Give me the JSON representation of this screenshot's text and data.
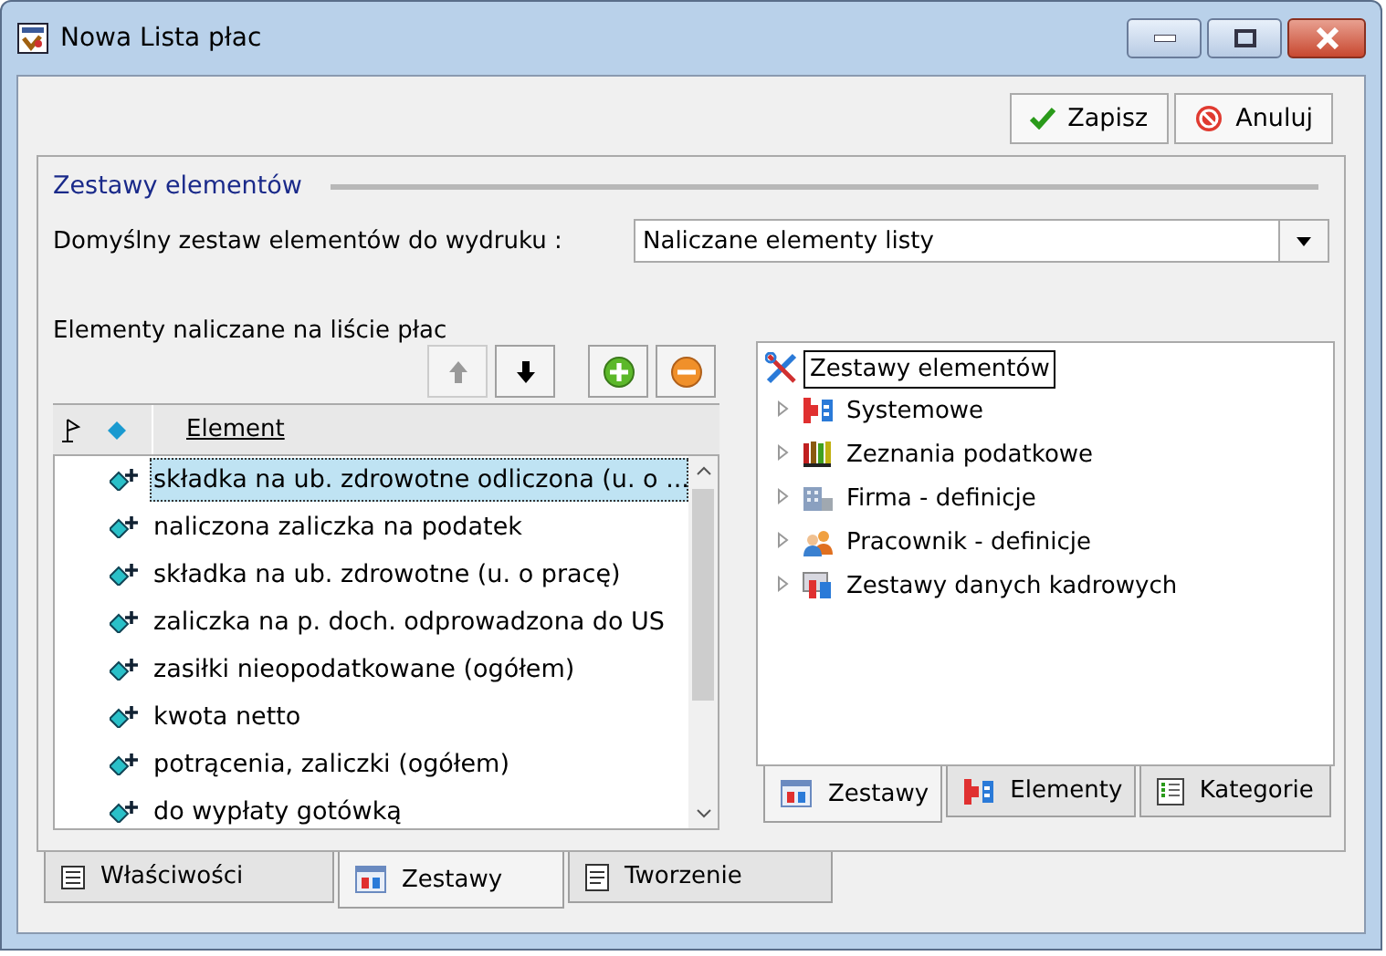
{
  "window": {
    "title": "Nowa Lista płac"
  },
  "actions": [
    {
      "label": "Zapisz",
      "kind": "save"
    },
    {
      "label": "Anuluj",
      "kind": "cancel"
    }
  ],
  "group": {
    "title": "Zestawy elementów"
  },
  "print_set": {
    "label": "Domyślny zestaw elementów do wydruku :",
    "value": "Naliczane elementy listy"
  },
  "elements": {
    "label": "Elementy naliczane na liście płac",
    "toolbar": [
      {
        "kind": "up",
        "disabled": true
      },
      {
        "kind": "down",
        "disabled": false
      },
      {
        "kind": "add",
        "disabled": false
      },
      {
        "kind": "remove",
        "disabled": false
      }
    ],
    "columns": [
      "Element"
    ],
    "rows": [
      {
        "text": "składka na ub. zdrowotne odliczona (u. o ...",
        "selected": true
      },
      {
        "text": "naliczona zaliczka na podatek",
        "selected": false
      },
      {
        "text": "składka na ub. zdrowotne (u. o pracę)",
        "selected": false
      },
      {
        "text": "zaliczka na p. doch. odprowadzona do US",
        "selected": false
      },
      {
        "text": "zasiłki nieopodatkowane (ogółem)",
        "selected": false
      },
      {
        "text": "kwota netto",
        "selected": false
      },
      {
        "text": "potrącenia, zaliczki (ogółem)",
        "selected": false
      },
      {
        "text": "do wypłaty gotówką",
        "selected": false
      }
    ]
  },
  "tree": {
    "root": "Zestawy elementów",
    "children": [
      {
        "label": "Systemowe",
        "kind": "system",
        "expanded": false
      },
      {
        "label": "Zeznania podatkowe",
        "kind": "books",
        "expanded": false
      },
      {
        "label": "Firma - definicje",
        "kind": "company",
        "expanded": false
      },
      {
        "label": "Pracownik - definicje",
        "kind": "people",
        "expanded": false
      },
      {
        "label": "Zestawy danych kadrowych",
        "kind": "hr",
        "expanded": false
      }
    ]
  },
  "tree_tabs": [
    {
      "label": "Zestawy",
      "kind": "sets",
      "selected": true
    },
    {
      "label": "Elementy",
      "kind": "system",
      "selected": false
    },
    {
      "label": "Kategorie",
      "kind": "list",
      "selected": false
    }
  ],
  "bottom_tabs": [
    {
      "label": "Właściwości",
      "kind": "props",
      "selected": false
    },
    {
      "label": "Zestawy",
      "kind": "sets",
      "selected": true
    },
    {
      "label": "Tworzenie",
      "kind": "doc",
      "selected": false
    }
  ]
}
